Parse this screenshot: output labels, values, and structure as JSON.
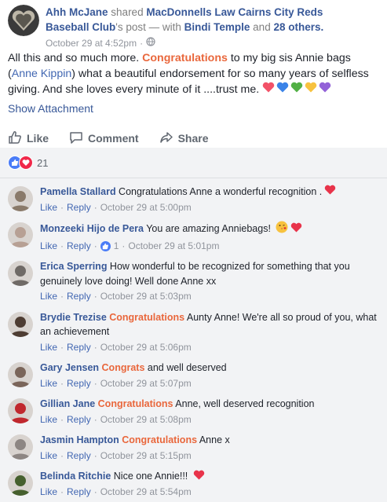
{
  "post": {
    "author": "Ahh McJane",
    "shared_text": "shared",
    "source": "MacDonnells Law Cairns City Reds Baseball Club",
    "source_suffix": "'s post",
    "with_text": " — with ",
    "tagged": "Bindi Temple",
    "and_text": " and ",
    "others": "28 others.",
    "time": "October 29 at 4:52pm",
    "body_1": "All this and so much more. ",
    "body_highlight": "Congratulations",
    "body_2": " to my big sis Annie bags (",
    "body_link": "Anne Kippin",
    "body_3": ") what a beautiful endorsement for so many years of selfless giving. And she loves every minute of it ....trust me. ",
    "show_attachment": "Show Attachment",
    "heart_colors": [
      "#f25268",
      "#3b83e8",
      "#52b045",
      "#f7c23f",
      "#9362d8"
    ]
  },
  "actions": {
    "like": "Like",
    "comment": "Comment",
    "share": "Share"
  },
  "reactions": {
    "count": "21"
  },
  "comments": [
    {
      "name": "Pamella Stallard",
      "pre": " Congratulations Anne a wonderful recognition .",
      "hl": "",
      "post": "",
      "emoji": "heart",
      "time": "October 29 at 5:00pm",
      "likes": "",
      "avatar": "#8a7a6a"
    },
    {
      "name": "Monzeeki Hijo de Pera",
      "pre": " You are amazing Anniebags! ",
      "hl": "",
      "post": "",
      "emoji": "kiss-heart",
      "time": "October 29 at 5:01pm",
      "likes": "1",
      "avatar": "#b7a094"
    },
    {
      "name": "Erica Sperring",
      "pre": " How wonderful to be recognized for something that you genuinely love doing! Well done Anne xx",
      "hl": "",
      "post": "",
      "emoji": "",
      "time": "October 29 at 5:03pm",
      "likes": "",
      "avatar": "#6f6a66"
    },
    {
      "name": "Brydie Trezise",
      "pre": " ",
      "hl": "Congratulations",
      "post": " Aunty Anne! We're all so proud of you, what an achievement",
      "emoji": "",
      "time": "October 29 at 5:06pm",
      "likes": "",
      "avatar": "#4e3d33"
    },
    {
      "name": "Gary Jensen",
      "pre": " ",
      "hl": "Congrats",
      "post": " and well deserved",
      "emoji": "",
      "time": "October 29 at 5:07pm",
      "likes": "",
      "avatar": "#7a655a"
    },
    {
      "name": "Gillian Jane",
      "pre": " ",
      "hl": "Congratulations",
      "post": " Anne, well deserved recognition",
      "emoji": "",
      "time": "October 29 at 5:08pm",
      "likes": "",
      "avatar": "#c0282e"
    },
    {
      "name": "Jasmin Hampton",
      "pre": " ",
      "hl": "Congratulations",
      "post": " Anne x",
      "emoji": "",
      "time": "October 29 at 5:15pm",
      "likes": "",
      "avatar": "#8d8683"
    },
    {
      "name": "Belinda Ritchie",
      "pre": " Nice one Annie!!! ",
      "hl": "",
      "post": "",
      "emoji": "heart",
      "time": "October 29 at 5:54pm",
      "likes": "",
      "avatar": "#46602e"
    }
  ],
  "comment_actions": {
    "like": "Like",
    "reply": "Reply",
    "sep": "·"
  }
}
